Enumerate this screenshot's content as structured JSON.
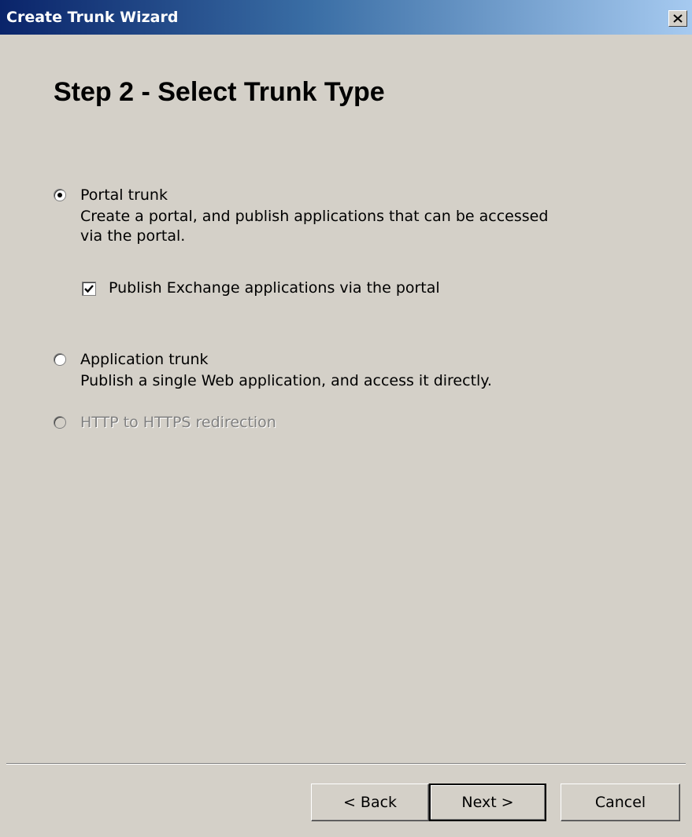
{
  "window": {
    "title": "Create Trunk Wizard",
    "close_icon": "close-icon"
  },
  "step": {
    "heading": "Step 2 - Select Trunk Type"
  },
  "options": {
    "portal": {
      "label": "Portal trunk",
      "description": "Create a portal, and publish applications that can be accessed via the portal.",
      "selected": true
    },
    "publish_exchange": {
      "label": "Publish Exchange applications via the portal",
      "checked": true
    },
    "application": {
      "label": "Application trunk",
      "description": "Publish a single Web application, and access it directly.",
      "selected": false
    },
    "http_redirect": {
      "label": "HTTP to HTTPS redirection",
      "enabled": false
    }
  },
  "buttons": {
    "back": "< Back",
    "next": "Next >",
    "cancel": "Cancel"
  }
}
